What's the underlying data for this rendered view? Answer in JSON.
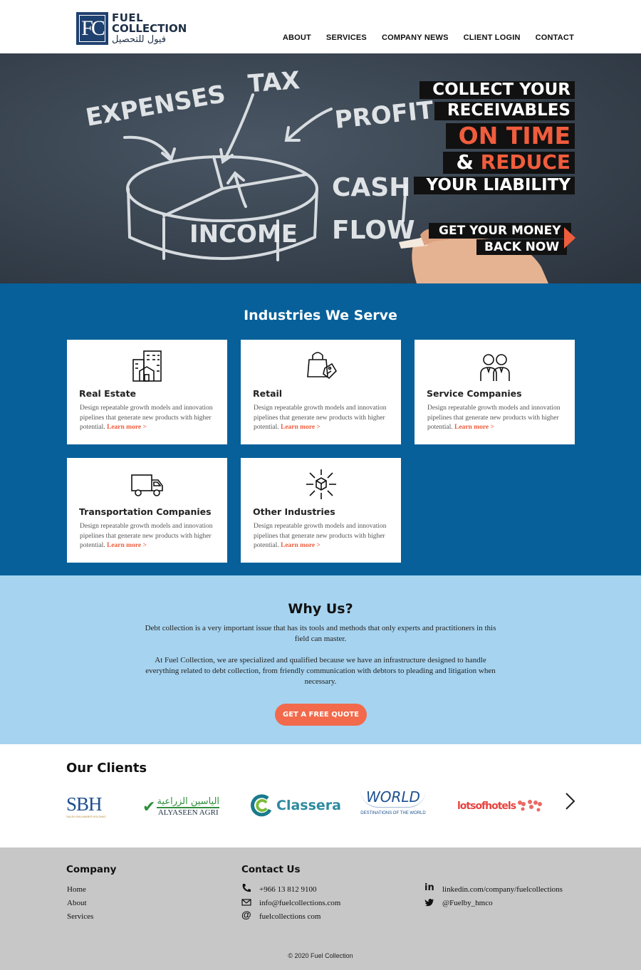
{
  "header": {
    "logo_mark": "FC",
    "logo_line1": "FUEL",
    "logo_line2": "COLLECTION",
    "logo_arabic": "فيول للتحصيل",
    "nav": [
      "ABOUT",
      "SERVICES",
      "COMPANY NEWS",
      "CLIENT LOGIN",
      "CONTACT"
    ]
  },
  "hero": {
    "chalk_words": [
      "EXPENSES",
      "TAX",
      "PROFIT",
      "CASH",
      "FLOW",
      "INCOME"
    ],
    "line1": "COLLECT YOUR",
    "line2": "RECEIVABLES",
    "line3": "ON TIME",
    "line4_prefix": "& ",
    "line4_red": "REDUCE",
    "line5": "YOUR LIABILITY",
    "cta_line1": "GET YOUR MONEY",
    "cta_line2": "BACK NOW"
  },
  "industries": {
    "title": "Industries We Serve",
    "cards": [
      {
        "title": "Real Estate",
        "desc": "Design repeatable growth models and innovation pipelines that generate new products with higher potential.",
        "link": "Learn more >",
        "icon": "building-icon"
      },
      {
        "title": "Retail",
        "desc": "Design repeatable growth models and innovation pipelines that generate new products with higher potential.",
        "link": "Learn more >",
        "icon": "shopping-bag-icon"
      },
      {
        "title": "Service Companies",
        "desc": "Design repeatable growth models and innovation pipelines that generate new products with higher potential.",
        "link": "Learn more >",
        "icon": "people-icon"
      },
      {
        "title": "Transportation Companies",
        "desc": "Design repeatable growth models and innovation pipelines that generate new products with higher potential.",
        "link": "Learn more >",
        "icon": "truck-icon"
      },
      {
        "title": "Other Industries",
        "desc": "Design repeatable growth models and innovation pipelines that generate new products with higher potential.",
        "link": "Learn more >",
        "icon": "box-network-icon"
      }
    ]
  },
  "why": {
    "title": "Why Us?",
    "p1": "Debt collection is a very important issue that has its tools and methods that only experts and practitioners in this field can master.",
    "p2": "At Fuel Collection, we are specialized and qualified because we have an infrastructure designed to handle everything related to debt collection, from friendly communication with debtors to pleading and litigation when necessary.",
    "button": "GET A FREE QUOTE"
  },
  "clients": {
    "title": "Our Clients",
    "logos": [
      {
        "name": "SBH",
        "sub": "SALEH BALHAMER HOLDING"
      },
      {
        "name": "الياسين الزراعية",
        "sub": "ALYASEEN AGRI"
      },
      {
        "name": "Classera",
        "sub": ""
      },
      {
        "name": "WORLD",
        "sub": "DESTINATIONS OF THE WORLD"
      },
      {
        "name": "lotsofhotels",
        "sub": ""
      }
    ]
  },
  "footer": {
    "company_title": "Company",
    "company_links": [
      "Home",
      "About",
      "Services"
    ],
    "contact_title": "Contact Us",
    "phone": "+966 13 812 9100",
    "email": "info@fuelcollections.com",
    "website": "fuelcollections com",
    "linkedin": "linkedin.com/company/fuelcollections",
    "twitter": "@Fuelby_hmco",
    "copyright": "© 2020 Fuel Collection"
  },
  "colors": {
    "brand_blue": "#07609a",
    "light_blue": "#a6d3ef",
    "accent": "#f05d3d",
    "navy": "#1f4170"
  }
}
